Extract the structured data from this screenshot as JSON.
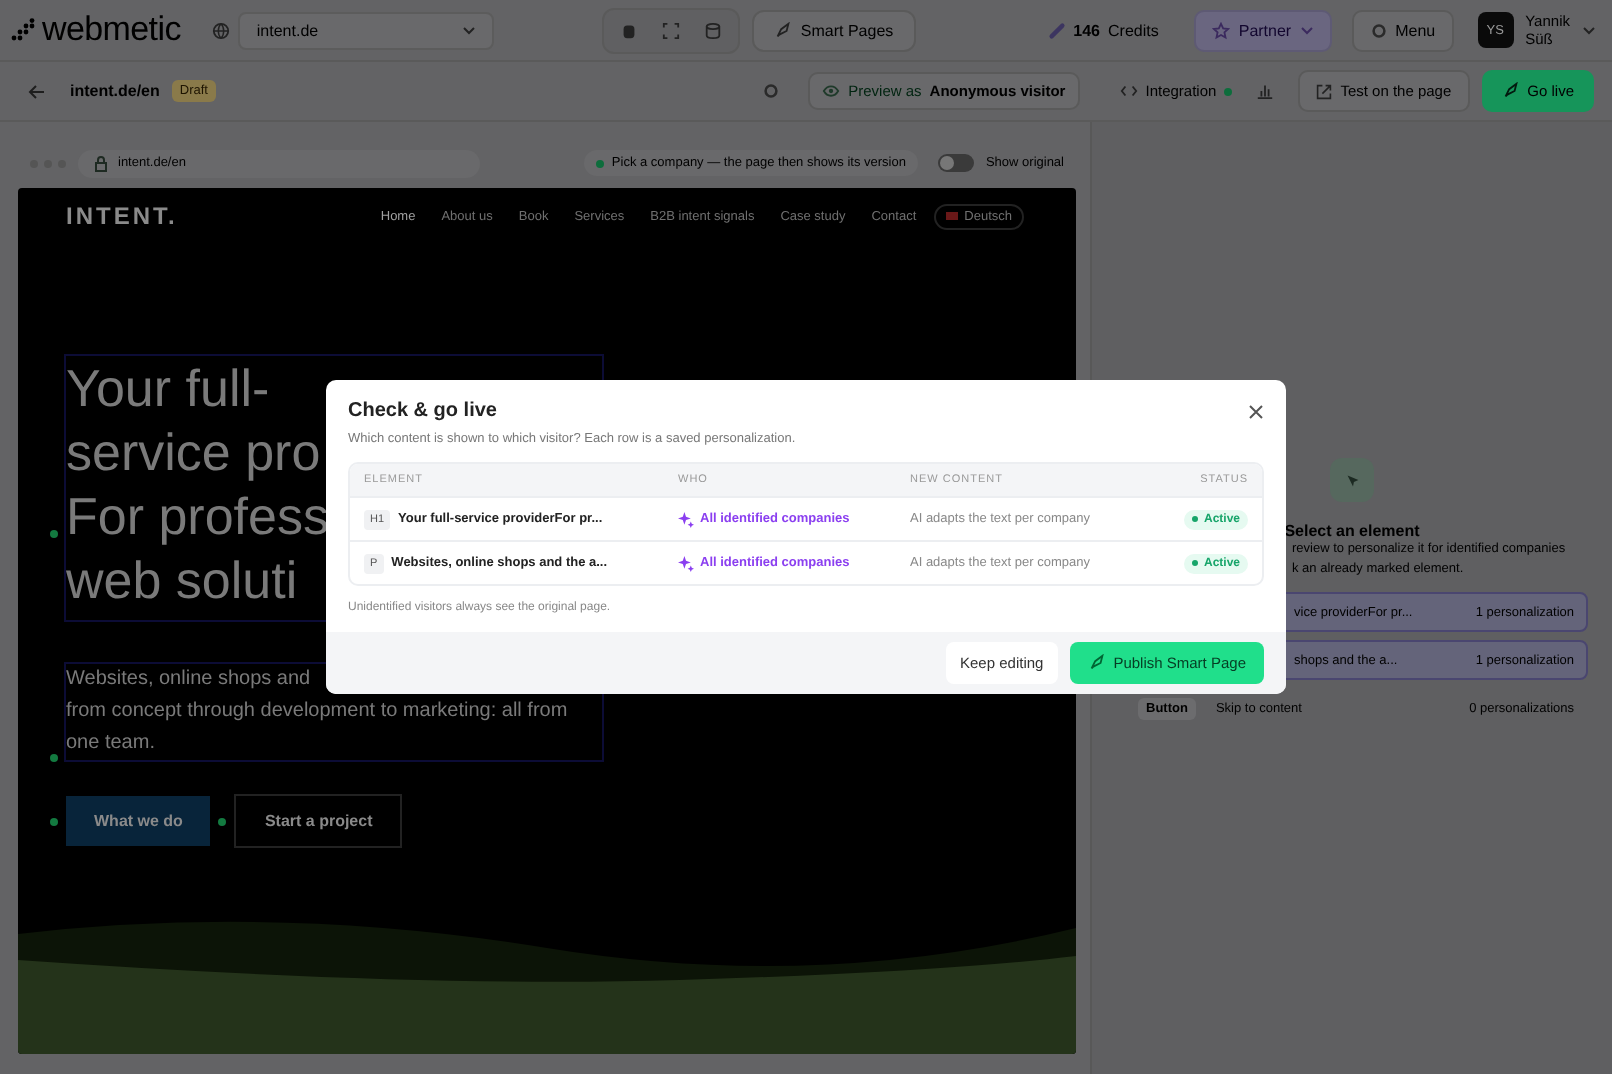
{
  "topbar": {
    "logo": "webmetic",
    "site": "intent.de",
    "smart_pages": "Smart Pages",
    "credits_value": "146",
    "credits_label": "Credits",
    "partner": "Partner",
    "menu": "Menu",
    "user": {
      "initials": "YS",
      "first": "Yannik",
      "last": "Süß"
    }
  },
  "subbar": {
    "url": "intent.de/en",
    "status": "Draft",
    "preview_label": "Preview as",
    "preview_value": "Anonymous visitor",
    "integration": "Integration",
    "test": "Test on the page",
    "go_live": "Go live"
  },
  "browser": {
    "url": "intent.de/en",
    "hint": "Pick a company — the page then shows its version",
    "toggle": {
      "label": "Show original",
      "on": false
    }
  },
  "site": {
    "logo": "INTENT.",
    "nav": [
      {
        "label": "Home",
        "selected": true
      },
      {
        "label": "About us",
        "selected": false
      },
      {
        "label": "Book",
        "selected": false
      },
      {
        "label": "Services",
        "selected": false
      },
      {
        "label": "B2B intent signals",
        "selected": false
      },
      {
        "label": "Case study",
        "selected": false
      },
      {
        "label": "Contact",
        "selected": false
      }
    ],
    "language": "Deutsch",
    "heading_lines": [
      "Your full-",
      "service pro",
      "For profess",
      "web soluti"
    ],
    "paragraph_lines": [
      "Websites, online shops and",
      "from concept through development to marketing: all from",
      "one team."
    ],
    "buttons": [
      "What we do",
      "Start a project"
    ]
  },
  "panel": {
    "title": "Select an element",
    "lines": [
      "review to personalize it for identified companies",
      "k an already marked element."
    ],
    "elements": [
      {
        "text": "vice providerFor pr...",
        "count": "1 personalization",
        "marked": true
      },
      {
        "text": "shops and the a...",
        "count": "1 personalization",
        "marked": true
      },
      {
        "tag": "Button",
        "text": "Skip to content",
        "count": "0 personalizations",
        "marked": false
      }
    ]
  },
  "modal": {
    "title": "Check & go live",
    "subtitle": "Which content is shown to which visitor? Each row is a saved personalization.",
    "columns": [
      "ELEMENT",
      "WHO",
      "NEW CONTENT",
      "STATUS"
    ],
    "rows": [
      {
        "tag": "H1",
        "element": "Your full-service providerFor pr...",
        "who": "All identified companies",
        "content": "AI adapts the text per company",
        "status": "Active",
        "active": true
      },
      {
        "tag": "P",
        "element": "Websites, online shops and the a...",
        "who": "All identified companies",
        "content": "AI adapts the text per company",
        "status": "Active",
        "active": true
      }
    ],
    "note": "Unidentified visitors always see the original page.",
    "cancel": "Keep editing",
    "publish": "Publish Smart Page"
  }
}
